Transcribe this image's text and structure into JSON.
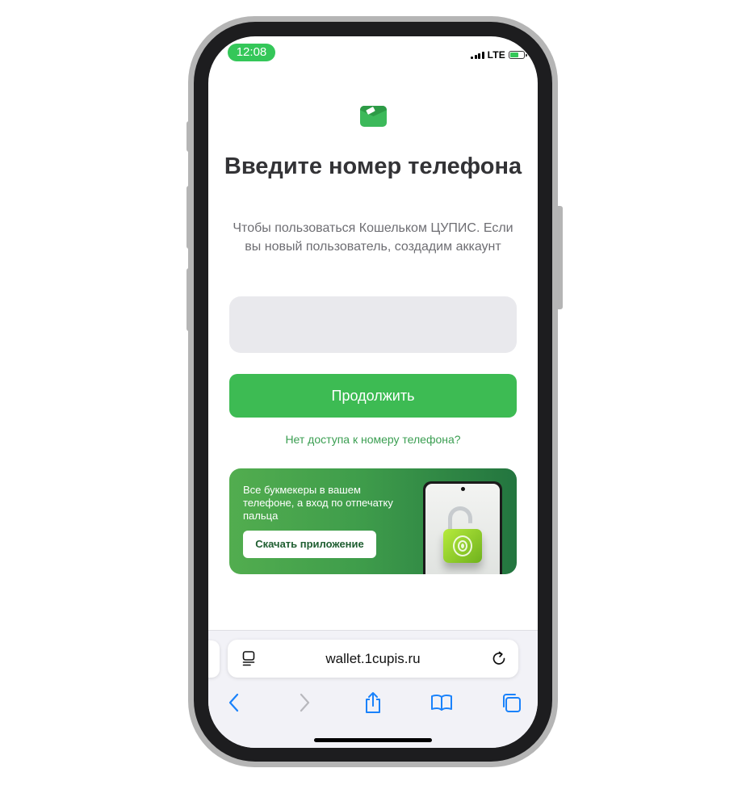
{
  "status_bar": {
    "time": "12:08",
    "network": "LTE"
  },
  "main": {
    "title": "Введите номер телефона",
    "subtitle": "Чтобы пользоваться Кошельком ЦУПИС. Если вы новый пользователь, создадим аккаунт",
    "phone_input": {
      "value": "",
      "placeholder": ""
    },
    "continue_label": "Продолжить",
    "no_access_link": "Нет доступа к номеру телефона?"
  },
  "promo": {
    "text": "Все букмекеры в вашем телефоне, а вход по отпечатку пальца",
    "button_label": "Скачать приложение"
  },
  "browser": {
    "url": "wallet.1cupis.ru"
  },
  "colors": {
    "accent": "#3dbb53",
    "time_pill": "#34c759",
    "link": "#3a9e51",
    "safari_blue": "#1a82fb"
  },
  "icons": {
    "logo": "wallet-logo-icon",
    "page": "page-menu-icon",
    "reload": "reload-icon",
    "back": "chevron-left-icon",
    "forward": "chevron-right-icon",
    "share": "share-icon",
    "bookmarks": "book-icon",
    "tabs": "tabs-icon"
  }
}
